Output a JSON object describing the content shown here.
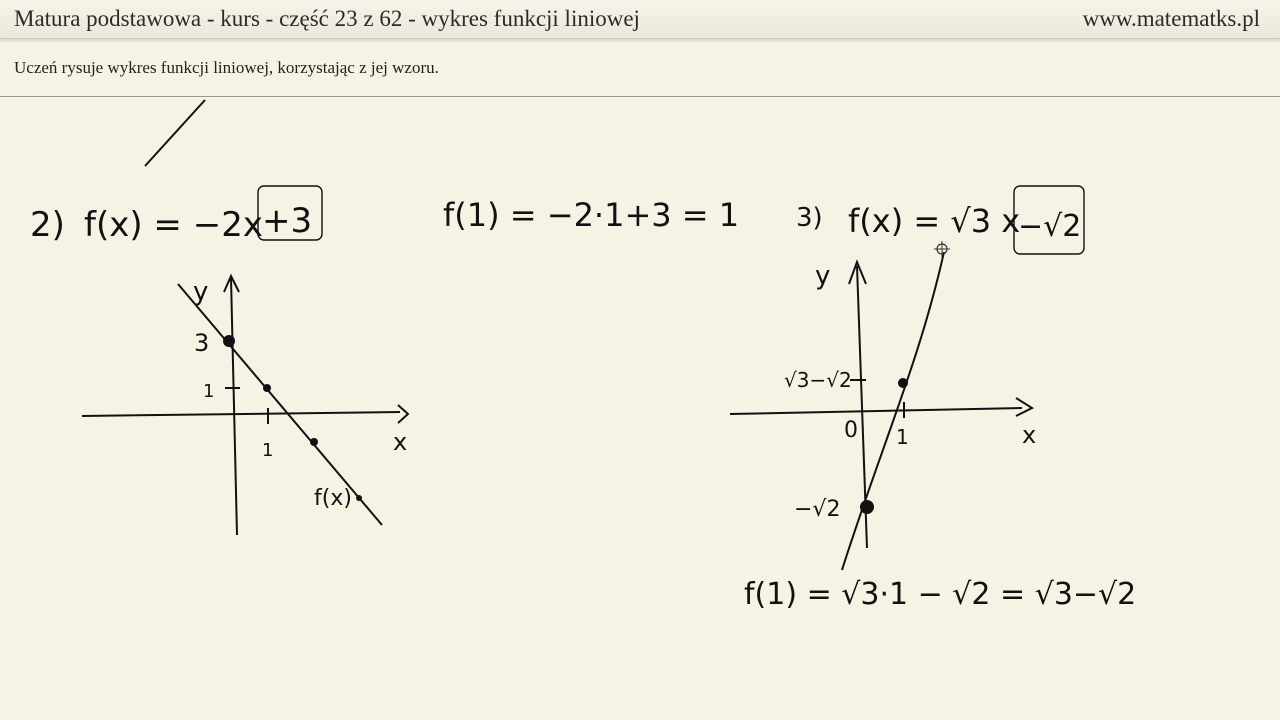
{
  "header": {
    "title": "Matura podstawowa - kurs - część 23 z 62 - wykres funkcji liniowej",
    "site": "www.matematks.pl"
  },
  "lesson": {
    "subtitle": "Uczeń rysuje wykres funkcji liniowej, korzystając z jej wzoru."
  },
  "board": {
    "ex2": {
      "number": "2)",
      "formula_main": "f(x) = −2x",
      "formula_boxed": "+3",
      "calc": "f(1) = −2·1+3 = 1",
      "y_label": "y",
      "x_label": "x",
      "tick_y3": "3",
      "tick_y1": "1",
      "tick_x1": "1",
      "graph_label": "f(x)"
    },
    "ex3": {
      "number": "3)",
      "formula_main": "f(x) = √3 x",
      "formula_boxed": "−√2",
      "y_label": "y",
      "x_label": "x",
      "origin": "0",
      "tick_x1": "1",
      "tick_top": "√3−√2",
      "tick_bottom": "−√2",
      "calc": "f(1) = √3·1 − √2 = √3−√2"
    }
  }
}
